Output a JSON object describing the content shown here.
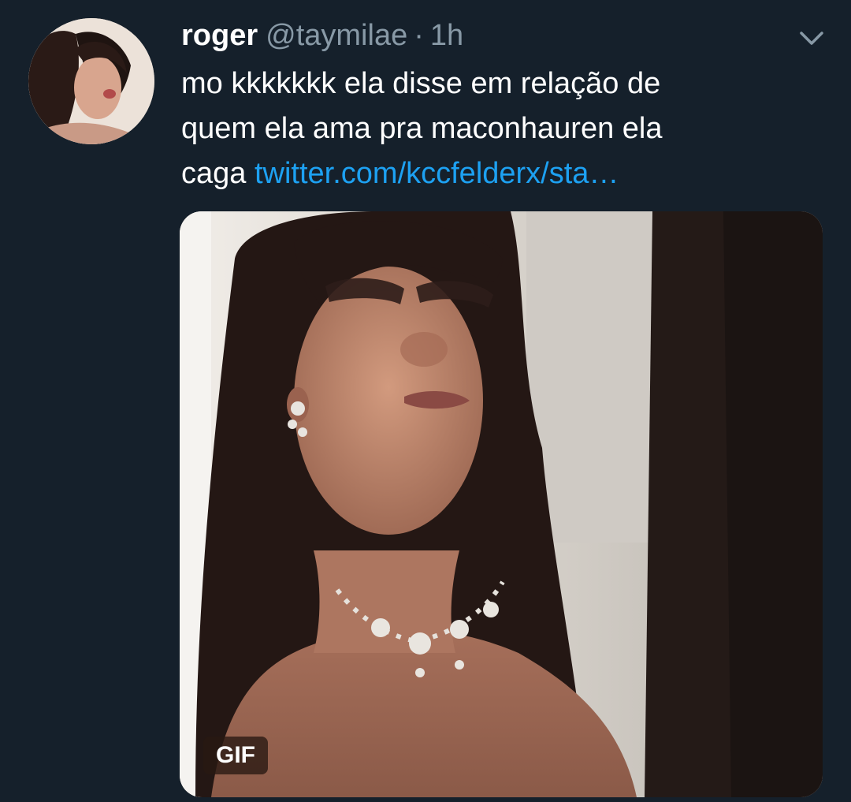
{
  "tweet": {
    "display_name": "roger",
    "handle": "@taymilae",
    "separator": "·",
    "time": "1h",
    "text_line1": "mo kkkkkkk ela disse em relação de",
    "text_line2": "quem ela ama pra maconhauren ela",
    "text_line3_prefix": "caga",
    "link": "twitter.com/kccfelderx/sta…",
    "media_badge": "GIF"
  },
  "icons": {
    "caret": "chevron-down-icon"
  },
  "colors": {
    "background": "#15202b",
    "primary_text": "#ffffff",
    "secondary_text": "#8899a6",
    "link": "#1da1f2"
  }
}
